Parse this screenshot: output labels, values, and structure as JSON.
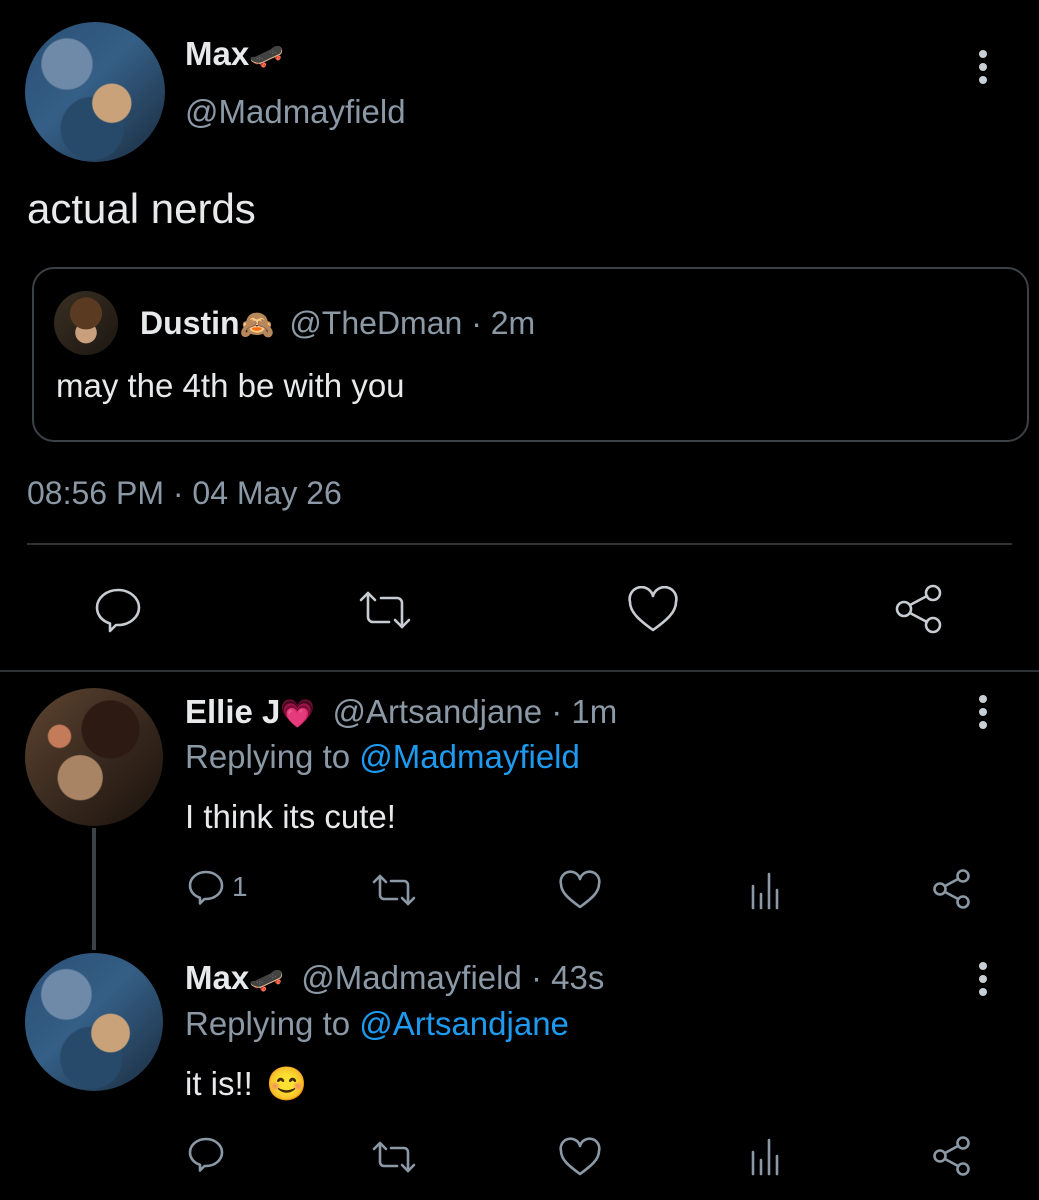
{
  "main_tweet": {
    "name": "Max",
    "name_emoji": "🛹",
    "handle": "@Madmayfield",
    "text": "actual nerds",
    "timestamp": "08:56 PM · 04 May 26",
    "quote": {
      "name": "Dustin",
      "name_emoji": "🙈",
      "handle": "@TheDman",
      "time": "· 2m",
      "text": "may the 4th be with you"
    }
  },
  "replies": [
    {
      "name": "Ellie J",
      "name_emoji": "💗",
      "handle": "@Artsandjane",
      "time": "· 1m",
      "replying_prefix": "Replying to",
      "replying_to": "@Madmayfield",
      "text": "I think its cute!",
      "reply_count": "1"
    },
    {
      "name": "Max",
      "name_emoji": "🛹",
      "handle": "@Madmayfield",
      "time": "· 43s",
      "replying_prefix": "Replying to",
      "replying_to": "@Artsandjane",
      "text": "it is!!",
      "text_emoji": "😊"
    }
  ],
  "icons": {
    "reply": "speech-bubble-icon",
    "retweet": "retweet-icon",
    "like": "heart-icon",
    "stats": "bar-chart-icon",
    "share": "share-icon",
    "more": "kebab-menu-icon"
  },
  "colors": {
    "background": "#000000",
    "text": "#e7e9ea",
    "muted": "#8b98a5",
    "link": "#1d9bf0",
    "divider": "#2f3336"
  }
}
